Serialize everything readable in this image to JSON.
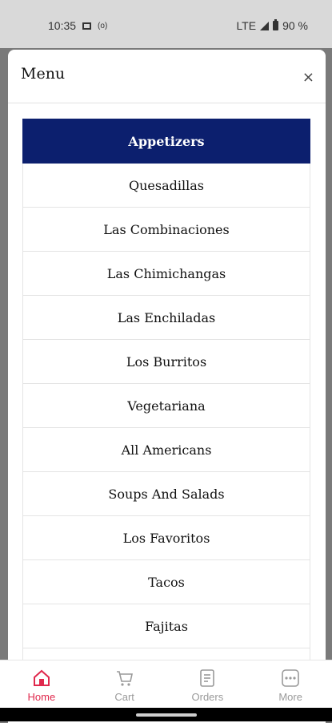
{
  "status_bar": {
    "time": "10:35",
    "network": "LTE",
    "battery": "90 %"
  },
  "menu": {
    "title": "Menu",
    "close_label": "×",
    "items": [
      {
        "label": "Appetizers",
        "active": true
      },
      {
        "label": "Quesadillas"
      },
      {
        "label": "Las Combinaciones"
      },
      {
        "label": "Las Chimichangas"
      },
      {
        "label": "Las Enchiladas"
      },
      {
        "label": "Los Burritos"
      },
      {
        "label": "Vegetariana"
      },
      {
        "label": "All Americans"
      },
      {
        "label": "Soups And Salads"
      },
      {
        "label": "Los Favoritos"
      },
      {
        "label": "Tacos"
      },
      {
        "label": "Fajitas"
      },
      {
        "label": ""
      }
    ]
  },
  "bottom_nav": {
    "items": [
      {
        "label": "Home",
        "icon": "home-icon",
        "active": true
      },
      {
        "label": "Cart",
        "icon": "cart-icon"
      },
      {
        "label": "Orders",
        "icon": "orders-icon"
      },
      {
        "label": "More",
        "icon": "more-icon"
      }
    ]
  },
  "colors": {
    "accent": "#e0294d",
    "active_item_bg": "#0c1f6e",
    "overlay": "#7a7a7a"
  }
}
